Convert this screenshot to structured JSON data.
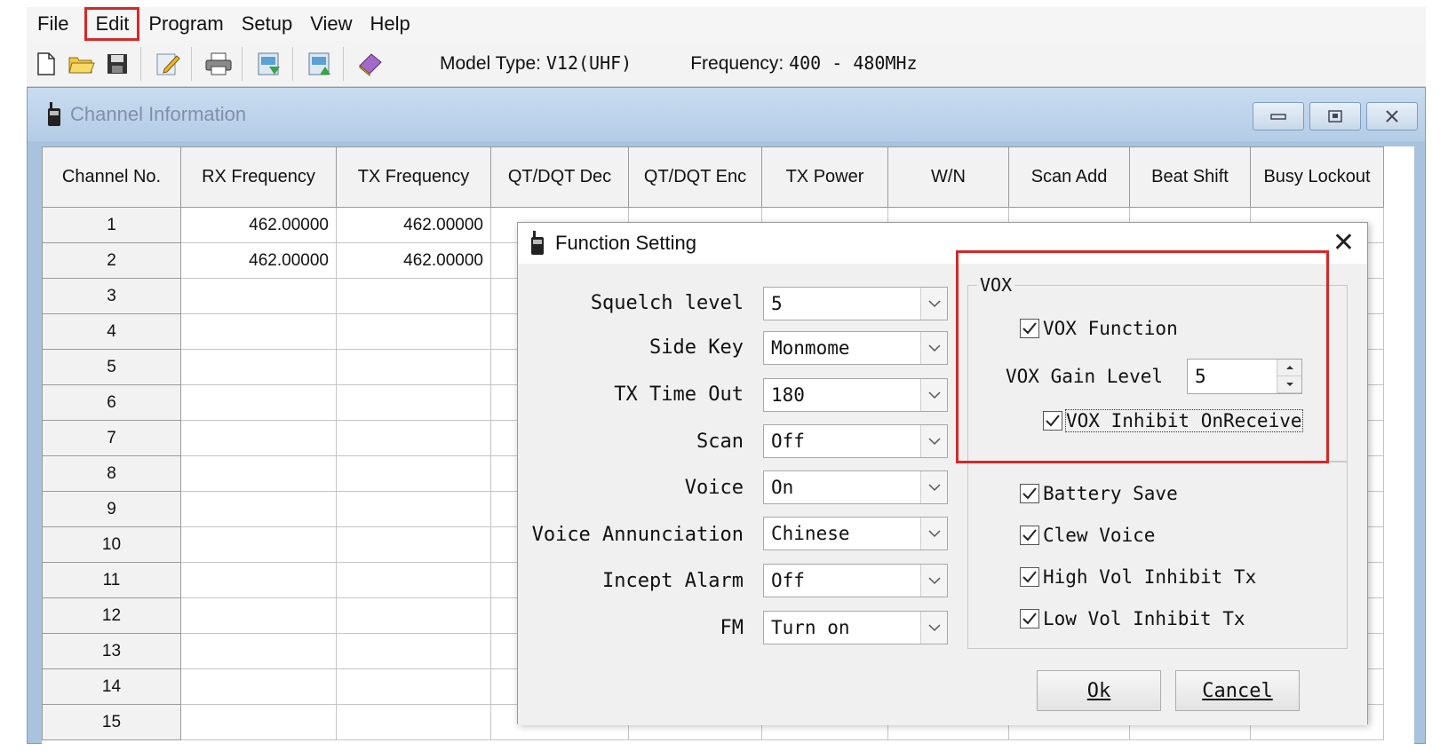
{
  "menu": [
    "File",
    "Edit",
    "Program",
    "Setup",
    "View",
    "Help"
  ],
  "toolbar": {
    "icons": [
      "new-file-icon",
      "open-folder-icon",
      "save-icon",
      "edit-icon",
      "print-icon",
      "read-radio-icon",
      "write-radio-icon",
      "about-book-icon"
    ],
    "model_label": "Model Type:",
    "model_value": "V12(UHF)",
    "freq_label": "Frequency:",
    "freq_value": "400 - 480MHz"
  },
  "channel_window": {
    "title": "Channel Information",
    "controls": [
      "minimize-icon",
      "restore-icon",
      "close-icon"
    ],
    "columns": [
      "Channel No.",
      "RX Frequency",
      "TX Frequency",
      "QT/DQT Dec",
      "QT/DQT Enc",
      "TX Power",
      "W/N",
      "Scan Add",
      "Beat Shift",
      "Busy Lockout"
    ],
    "rows": [
      {
        "no": "1",
        "rx": "462.00000",
        "tx": "462.00000"
      },
      {
        "no": "2",
        "rx": "462.00000",
        "tx": "462.00000"
      },
      {
        "no": "3",
        "rx": "",
        "tx": ""
      },
      {
        "no": "4",
        "rx": "",
        "tx": ""
      },
      {
        "no": "5",
        "rx": "",
        "tx": ""
      },
      {
        "no": "6",
        "rx": "",
        "tx": ""
      },
      {
        "no": "7",
        "rx": "",
        "tx": ""
      },
      {
        "no": "8",
        "rx": "",
        "tx": ""
      },
      {
        "no": "9",
        "rx": "",
        "tx": ""
      },
      {
        "no": "10",
        "rx": "",
        "tx": ""
      },
      {
        "no": "11",
        "rx": "",
        "tx": ""
      },
      {
        "no": "12",
        "rx": "",
        "tx": ""
      },
      {
        "no": "13",
        "rx": "",
        "tx": ""
      },
      {
        "no": "14",
        "rx": "",
        "tx": ""
      },
      {
        "no": "15",
        "rx": "",
        "tx": ""
      }
    ]
  },
  "dialog": {
    "title": "Function Setting",
    "fields": [
      {
        "label": "Squelch level",
        "value": "5"
      },
      {
        "label": "Side Key",
        "value": "Monmome"
      },
      {
        "label": "TX Time Out",
        "value": "180"
      },
      {
        "label": "Scan",
        "value": "Off"
      },
      {
        "label": "Voice",
        "value": "On"
      },
      {
        "label": "Voice Annunciation",
        "value": "Chinese"
      },
      {
        "label": "Incept Alarm",
        "value": "Off"
      },
      {
        "label": "FM",
        "value": "Turn on"
      }
    ],
    "vox": {
      "legend": "VOX",
      "function_label": "VOX Function",
      "function_checked": true,
      "gain_label": "VOX Gain Level",
      "gain_value": "5",
      "inhibit_label": "VOX Inhibit OnReceive",
      "inhibit_checked": true
    },
    "options": [
      {
        "label": "Battery Save",
        "checked": true
      },
      {
        "label": "Clew Voice",
        "checked": true
      },
      {
        "label": "High Vol Inhibit Tx",
        "checked": true
      },
      {
        "label": "Low Vol Inhibit Tx",
        "checked": true
      }
    ],
    "ok_label": "Ok",
    "cancel_label": "Cancel"
  },
  "colors": {
    "highlight": "#d62828",
    "title_bar": "#b4cce6"
  }
}
